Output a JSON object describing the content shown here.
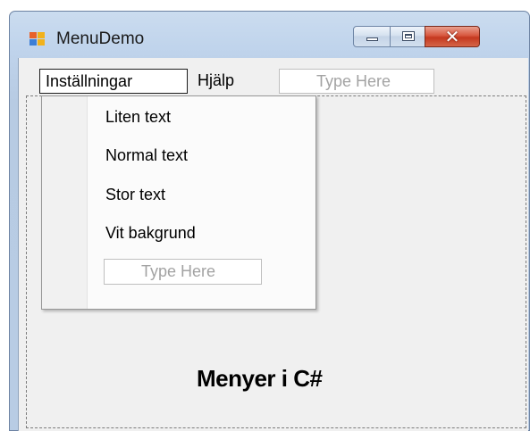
{
  "window": {
    "title": "MenuDemo",
    "icon": "app-window-icon",
    "controls": {
      "minimize": "minimize-icon",
      "maximize": "maximize-icon",
      "close": "✕"
    }
  },
  "menubar": {
    "items": [
      {
        "label": "Inställningar",
        "open": true
      },
      {
        "label": "Hjälp",
        "open": false
      }
    ],
    "type_here": "Type Here"
  },
  "dropdown": {
    "items": [
      {
        "label": "Liten text"
      },
      {
        "label": "Normal text"
      },
      {
        "label": "Stor text"
      },
      {
        "label": "Vit bakgrund"
      }
    ],
    "type_here": "Type Here"
  },
  "form": {
    "label": "Menyer i C#"
  },
  "colors": {
    "titlebar": "#c0d4ec",
    "client": "#f0f0f0",
    "close_button": "#c4381f"
  }
}
